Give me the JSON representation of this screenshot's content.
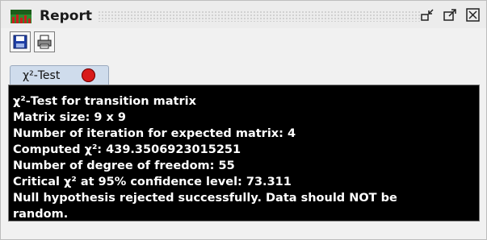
{
  "window": {
    "title": "Report"
  },
  "toolbar": {
    "buttons": [
      {
        "icon": "save-icon"
      },
      {
        "icon": "print-icon"
      }
    ]
  },
  "tabs": [
    {
      "label": "χ²-Test",
      "status_color": "#d81a1a"
    }
  ],
  "report": {
    "lines": [
      "χ²-Test for transition matrix",
      "Matrix size: 9 x 9",
      "Number of iteration for expected matrix: 4",
      "Computed χ²: 439.3506923015251",
      "Number of degree of freedom: 55",
      "Critical χ² at 95% confidence level: 73.311",
      "Null hypothesis rejected successfully. Data should NOT be",
      "random."
    ]
  },
  "colors": {
    "report_background": "#000000",
    "report_text": "#ffffff",
    "tab_background": "#cfdcec"
  }
}
